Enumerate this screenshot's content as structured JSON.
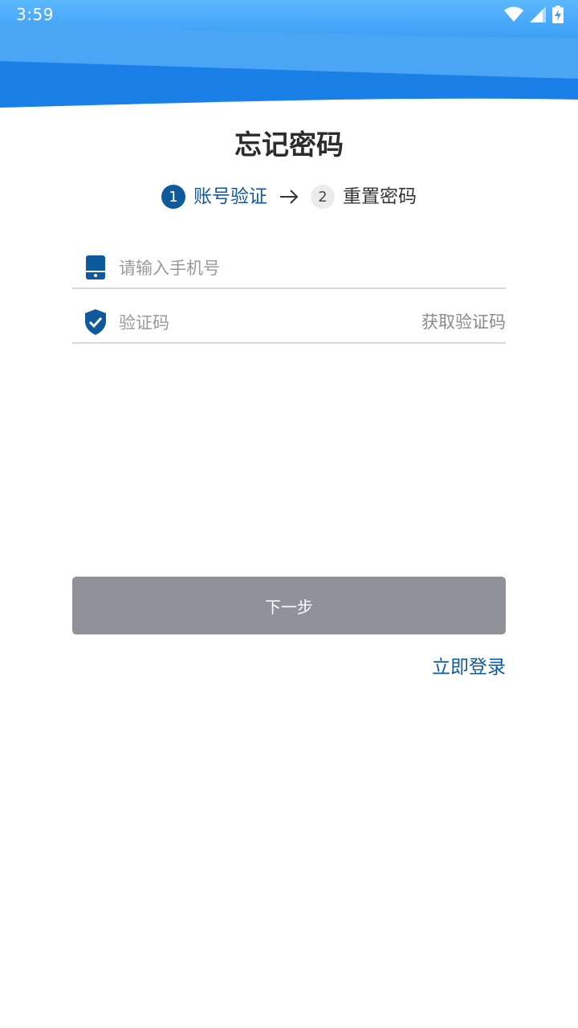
{
  "status_bar": {
    "time": "3:59",
    "icons": [
      "wifi-icon",
      "cellular-signal-icon",
      "battery-charging-icon"
    ]
  },
  "page": {
    "title": "忘记密码"
  },
  "steps": [
    {
      "number": "1",
      "label": "账号验证",
      "active": true
    },
    {
      "number": "2",
      "label": "重置密码",
      "active": false
    }
  ],
  "form": {
    "phone": {
      "icon": "phone-icon",
      "value": "",
      "placeholder": "请输入手机号"
    },
    "code": {
      "icon": "shield-check-icon",
      "value": "",
      "placeholder": "验证码"
    },
    "get_code_label": "获取验证码"
  },
  "actions": {
    "next_label": "下一步",
    "login_label": "立即登录"
  },
  "colors": {
    "primary": "#0e5a9c",
    "header_blue": "#1a7fe6",
    "button_disabled": "#8f9298"
  }
}
